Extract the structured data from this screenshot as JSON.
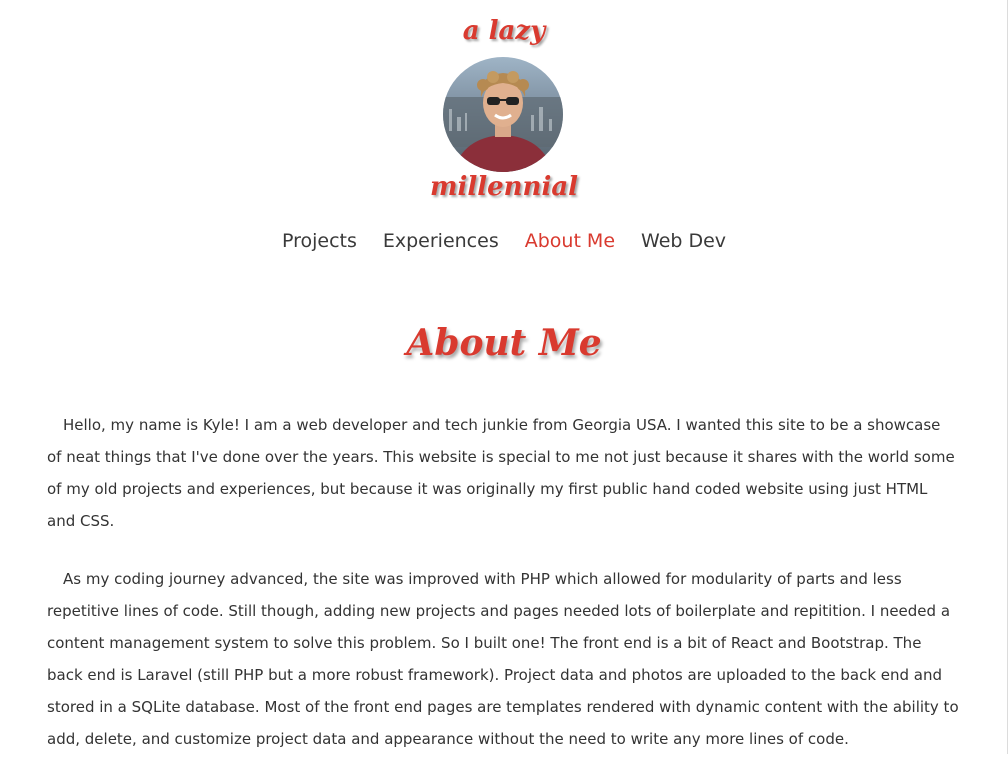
{
  "header": {
    "brand_top": "a lazy",
    "brand_bottom": "millennial",
    "avatar_icon": "profile-photo"
  },
  "nav": {
    "items": [
      {
        "label": "Projects",
        "active": false
      },
      {
        "label": "Experiences",
        "active": false
      },
      {
        "label": "About Me",
        "active": true
      },
      {
        "label": "Web Dev",
        "active": false
      }
    ]
  },
  "main": {
    "title": "About Me",
    "paragraphs": [
      "Hello, my name is Kyle! I am a web developer and tech junkie from Georgia USA. I wanted this site to be a showcase of neat things that I've done over the years. This website is special to me not just because it shares with the world some of my old projects and experiences, but because it was originally my first public hand coded website using just HTML and CSS.",
      "As my coding journey advanced, the site was improved with PHP which allowed for modularity of parts and less repetitive lines of code. Still though, adding new projects and pages needed lots of boilerplate and repitition. I needed a content management system to solve this problem. So I built one! The front end is a bit of React and Bootstrap. The back end is Laravel (still PHP but a more robust framework). Project data and photos are uploaded to the back end and stored in a SQLite database. Most of the front end pages are templates rendered with dynamic content with the ability to add, delete, and customize project data and appearance without the need to write any more lines of code."
    ]
  },
  "colors": {
    "accent": "#d93a2f",
    "text": "#333333",
    "background": "#ffffff"
  }
}
